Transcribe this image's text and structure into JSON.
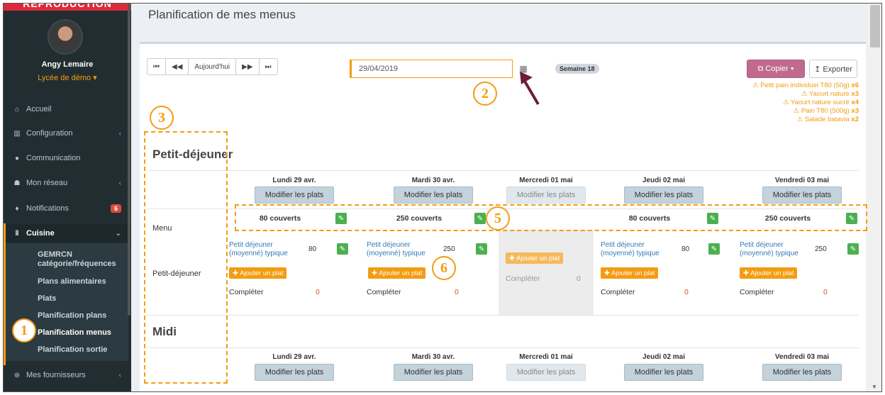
{
  "sidebar": {
    "ribbon": "REPRODUCTION",
    "user_name": "Angy Lemaire",
    "school": "Lycée de démo ▾",
    "items": [
      {
        "label": "Accueil",
        "icon": "⌂"
      },
      {
        "label": "Configuration",
        "icon": "▥"
      },
      {
        "label": "Communication",
        "icon": "●"
      },
      {
        "label": "Mon réseau",
        "icon": "☗"
      },
      {
        "label": "Notifications",
        "icon": "♦",
        "badge": "6"
      },
      {
        "label": "Cuisine",
        "icon": "‖"
      },
      {
        "label": "Mes fournisseurs",
        "icon": "⊛"
      }
    ],
    "cuisine_sub": [
      "GEMRCN catégorie/fréquences",
      "Plans alimentaires",
      "Plats",
      "Planification plans",
      "Planification menus",
      "Planification sortie"
    ]
  },
  "page": {
    "title": "Planification de mes menus"
  },
  "toolbar": {
    "first": "⏮",
    "prev": "◀◀",
    "today": "Aujourd'hui",
    "next": "▶▶",
    "last": "⏭",
    "date_value": "29/04/2019",
    "calendar_icon": "▦",
    "week_badge": "Semaine 18",
    "copy": "⧉ Copier ▾",
    "export": "↥ Exporter"
  },
  "warnings": [
    {
      "text": "⚠ Petit pain individuel T80 (50g) ",
      "count": "x6"
    },
    {
      "text": "⚠ Yaourt nature ",
      "count": "x3"
    },
    {
      "text": "⚠ Yaourt nature sucré ",
      "count": "x4"
    },
    {
      "text": "⚠ Pain T80 (500g) ",
      "count": "x3"
    },
    {
      "text": "⚠ Salade batavia ",
      "count": "x2"
    }
  ],
  "sections": {
    "breakfast": "Petit-déjeuner",
    "lunch": "Midi"
  },
  "days": [
    {
      "label": "Lundi 29 avr.",
      "covers": "80 couverts",
      "dish": "Petit déjeuner (moyenné) typique",
      "qty": "80",
      "complete": "Compléter",
      "count": "0"
    },
    {
      "label": "Mardi 30 avr.",
      "covers": "250 couverts",
      "dish": "Petit déjeuner (moyenné) typique",
      "qty": "250",
      "complete": "Compléter",
      "count": "0"
    },
    {
      "label": "Mercredi 01 mai",
      "covers": "",
      "dish": "",
      "qty": "",
      "complete": "Compléter",
      "count": "0"
    },
    {
      "label": "Jeudi 02 mai",
      "covers": "80 couverts",
      "dish": "Petit déjeuner (moyenné) typique",
      "qty": "80",
      "complete": "Compléter",
      "count": "0"
    },
    {
      "label": "Vendredi 03 mai",
      "covers": "250 couverts",
      "dish": "Petit déjeuner (moyenné) typique",
      "qty": "250",
      "complete": "Compléter",
      "count": "0"
    }
  ],
  "labels": {
    "modify": "Modifier les plats",
    "menu_row": "Menu",
    "breakfast_row": "Petit-déjeuner",
    "add_dish": "✚ Ajouter un plat",
    "edit_icon": "✎"
  },
  "markers": [
    "1",
    "2",
    "3",
    "5",
    "6"
  ],
  "colors": {
    "accent": "#f39c12",
    "sidebar_bg": "#222d32",
    "copy_btn": "#c06a8e",
    "edit_btn": "#4caf50",
    "link": "#337ab7"
  }
}
